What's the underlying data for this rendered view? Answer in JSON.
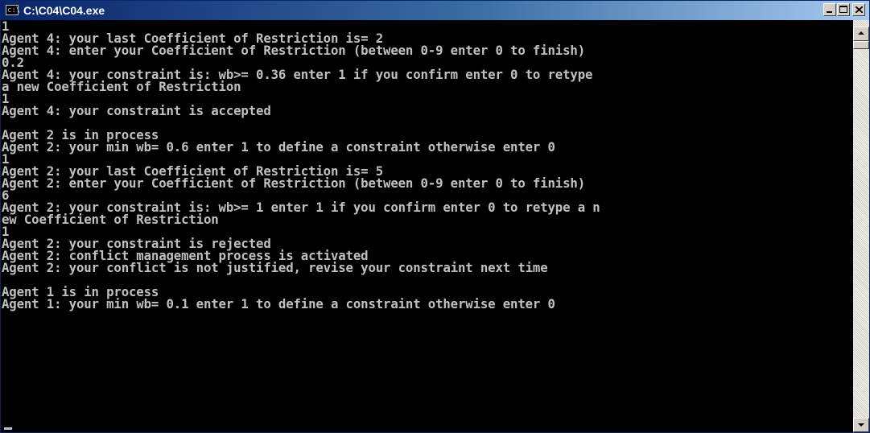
{
  "window": {
    "title": "C:\\C04\\C04.exe",
    "icon_label": "c:\\",
    "icon": "console-app-icon"
  },
  "controls": {
    "minimize_icon": "minimize-icon",
    "maximize_icon": "maximize-icon",
    "close_icon": "close-icon"
  },
  "console": {
    "lines": [
      "1",
      "Agent 4: your last Coefficient of Restriction is= 2",
      "Agent 4: enter your Coefficient of Restriction (between 0-9 enter 0 to finish)",
      "0.2",
      "Agent 4: your constraint is: wb>= 0.36 enter 1 if you confirm enter 0 to retype",
      "a new Coefficient of Restriction",
      "1",
      "Agent 4: your constraint is accepted",
      "",
      "Agent 2 is in process",
      "Agent 2: your min wb= 0.6 enter 1 to define a constraint otherwise enter 0",
      "1",
      "Agent 2: your last Coefficient of Restriction is= 5",
      "Agent 2: enter your Coefficient of Restriction (between 0-9 enter 0 to finish)",
      "6",
      "Agent 2: your constraint is: wb>= 1 enter 1 if you confirm enter 0 to retype a n",
      "ew Coefficient of Restriction",
      "1",
      "Agent 2: your constraint is rejected",
      "Agent 2: conflict management process is activated",
      "Agent 2: your conflict is not justified, revise your constraint next time",
      "",
      "Agent 1 is in process",
      "Agent 1: your min wb= 0.1 enter 1 to define a constraint otherwise enter 0"
    ]
  },
  "colors": {
    "console_background": "#000000",
    "console_text": "#c0c0c0",
    "titlebar_start": "#0a246a",
    "titlebar_end": "#a6caf0"
  }
}
